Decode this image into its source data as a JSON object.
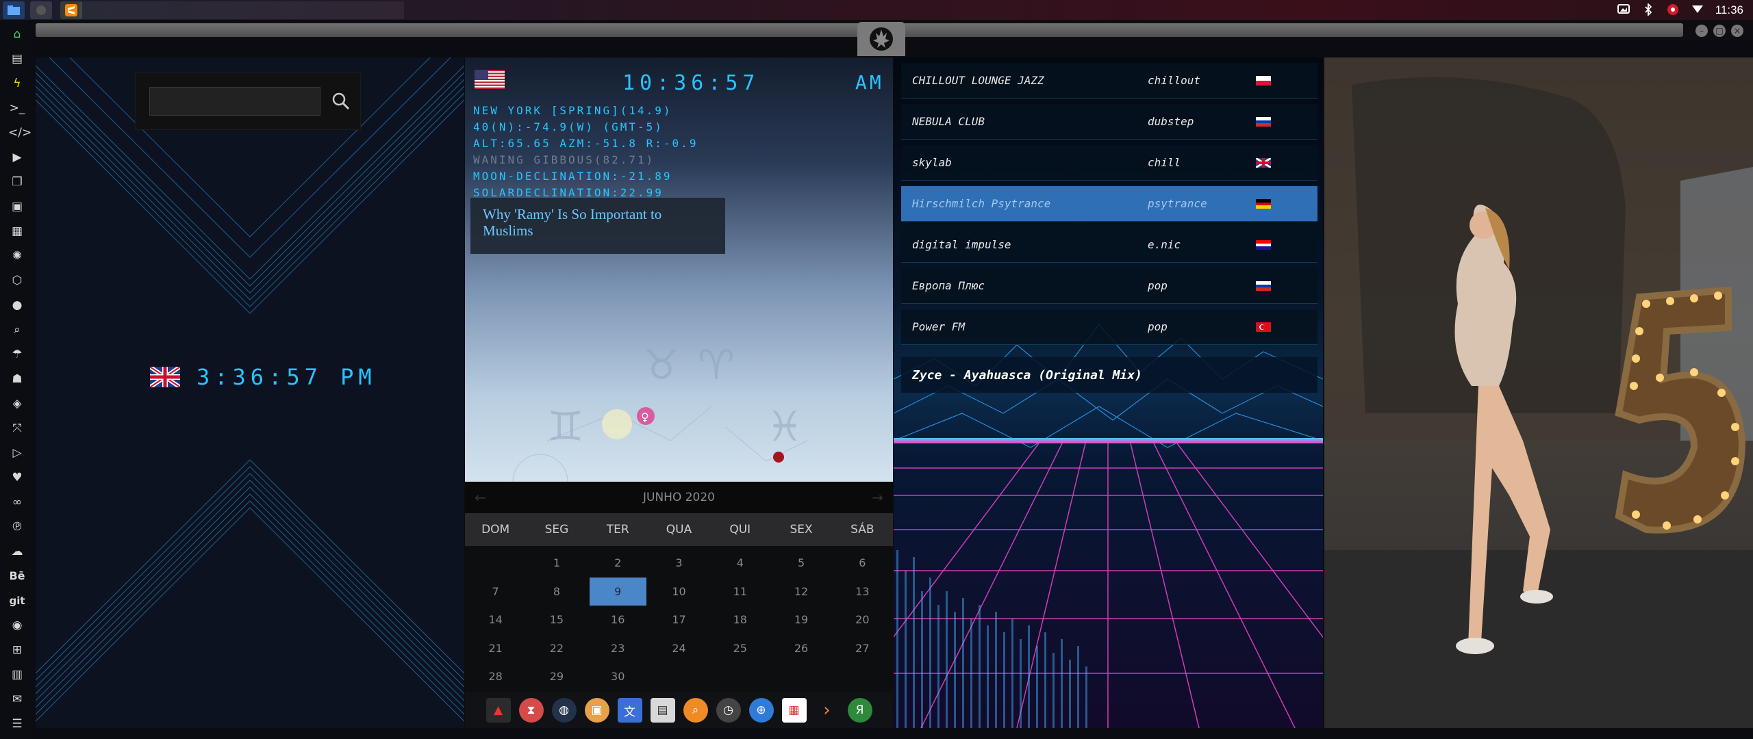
{
  "system": {
    "clock": "11:36",
    "tray_icons": [
      "screenshot-icon",
      "bluetooth-icon",
      "network-icon",
      "wifi-icon"
    ]
  },
  "dock": {
    "items": [
      "home-icon",
      "file-icon",
      "bolt-icon",
      "terminal-icon",
      "code-icon",
      "play-icon",
      "files-icon",
      "image-icon",
      "news-icon",
      "settings-icon",
      "hexagon-icon",
      "globe-icon",
      "search-icon",
      "umbrella-icon",
      "contact-icon",
      "gamepad-icon",
      "expand-icon",
      "youtube-icon",
      "heart-icon",
      "infinity-icon",
      "pinterest-icon",
      "cloud-icon",
      "behance-icon",
      "git-icon",
      "github-icon",
      "sitemap-icon",
      "map-icon",
      "mail-icon",
      "storage-icon"
    ],
    "behance_label": "Bē",
    "git_label": "git"
  },
  "world_clock": {
    "search_placeholder": "",
    "time": "3:36:57  PM"
  },
  "astro": {
    "time": "10:36:57",
    "ampm": "AM",
    "lines": [
      "NEW YORK [SPRING](14.9)",
      "40(N):-74.9(W) (GMT-5)",
      "ALT:65.65 AZM:-51.8 R:-0.9",
      "WANING GIBBOUS(82.71)",
      "MOON-DECLINATION:-21.89",
      "SOLARDECLINATION:22.99"
    ],
    "news_title": "Why 'Ramy' Is So Important to Muslims"
  },
  "calendar": {
    "month_label": "JUNHO 2020",
    "weekdays": [
      "DOM",
      "SEG",
      "TER",
      "QUA",
      "QUI",
      "SEX",
      "SÁB"
    ],
    "days": [
      "",
      "1",
      "2",
      "3",
      "4",
      "5",
      "6",
      "7",
      "8",
      "9",
      "10",
      "11",
      "12",
      "13",
      "14",
      "15",
      "16",
      "17",
      "18",
      "19",
      "20",
      "21",
      "22",
      "23",
      "24",
      "25",
      "26",
      "27",
      "28",
      "29",
      "30"
    ],
    "today": "9"
  },
  "radio": {
    "stations": [
      {
        "name": "CHILLOUT LOUNGE JAZZ",
        "genre": "chillout",
        "flag": "pl"
      },
      {
        "name": "NEBULA CLUB",
        "genre": "dubstep",
        "flag": "ru"
      },
      {
        "name": "skylab",
        "genre": "chill",
        "flag": "uk"
      },
      {
        "name": "Hirschmilch Psytrance",
        "genre": "psytrance",
        "flag": "de"
      },
      {
        "name": "digital impulse",
        "genre": "e.nic",
        "flag": "hr"
      },
      {
        "name": "Европа Плюс",
        "genre": "pop",
        "flag": "ru"
      },
      {
        "name": "Power FM",
        "genre": "pop",
        "flag": "tr"
      }
    ],
    "active_index": 3,
    "now_playing": "Zyce - Ayahuasca (Original Mix)"
  },
  "colors": {
    "digital": "#29c4ff",
    "active_station": "#2f6fb6",
    "today": "#4a86c8"
  }
}
